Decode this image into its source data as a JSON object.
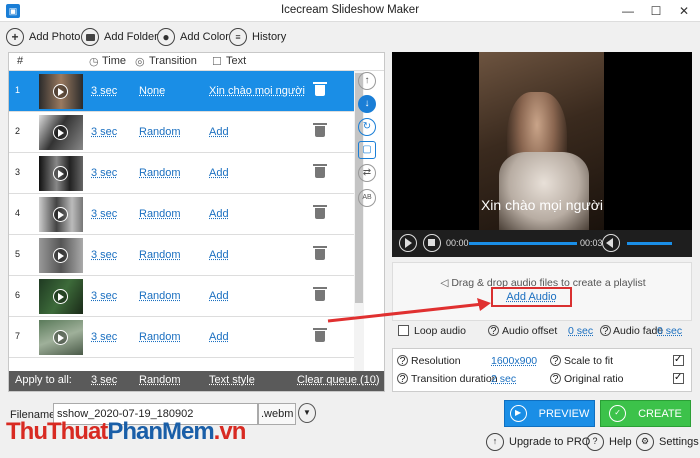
{
  "window": {
    "title": "Icecream Slideshow Maker",
    "icon": "app-logo-icon"
  },
  "toolbar": [
    {
      "label": "Add Photo",
      "icon": "plus-icon"
    },
    {
      "label": "Add Folder",
      "icon": "folder-icon"
    },
    {
      "label": "Add Color",
      "icon": "palette-icon"
    },
    {
      "label": "History",
      "icon": "list-icon"
    }
  ],
  "list": {
    "headers": {
      "num": "#",
      "time": "Time",
      "transition": "Transition",
      "text": "Text"
    },
    "rows": [
      {
        "index": "1",
        "time": "3 sec",
        "transition": "None",
        "text": "Xin chào mọi người",
        "selected": true
      },
      {
        "index": "2",
        "time": "3 sec",
        "transition": "Random",
        "text": "Add",
        "selected": false
      },
      {
        "index": "3",
        "time": "3 sec",
        "transition": "Random",
        "text": "Add",
        "selected": false
      },
      {
        "index": "4",
        "time": "3 sec",
        "transition": "Random",
        "text": "Add",
        "selected": false
      },
      {
        "index": "5",
        "time": "3 sec",
        "transition": "Random",
        "text": "Add",
        "selected": false
      },
      {
        "index": "6",
        "time": "3 sec",
        "transition": "Random",
        "text": "Add",
        "selected": false
      },
      {
        "index": "7",
        "time": "3 sec",
        "transition": "Random",
        "text": "Add",
        "selected": false
      }
    ],
    "apply_all": {
      "label": "Apply to all:",
      "time": "3 sec",
      "transition": "Random",
      "text_style": "Text style",
      "clear": "Clear queue (10)"
    }
  },
  "side_tools": [
    "move-up-icon",
    "move-down-icon",
    "rotate-icon",
    "crop-icon",
    "shuffle-icon",
    "ab-text-icon"
  ],
  "preview": {
    "caption": "Xin chào mọi người",
    "time_start": "00:00",
    "time_end": "00:03"
  },
  "audio": {
    "hint": "Drag & drop audio files to create a playlist",
    "add_audio": "Add Audio",
    "loop_label": "Loop audio",
    "offset_label": "Audio offset",
    "offset_value": "0 sec",
    "fade_label": "Audio fade",
    "fade_value": "0 sec"
  },
  "settings": {
    "resolution_label": "Resolution",
    "resolution_value": "1600x900",
    "transition_label": "Transition duration",
    "transition_value": "2 sec",
    "scale_label": "Scale to fit",
    "ratio_label": "Original ratio"
  },
  "output": {
    "filename_label": "Filename:",
    "filename": "sshow_2020-07-19_180902",
    "extension": ".webm",
    "preview_label": "PREVIEW",
    "create_label": "CREATE"
  },
  "footer": {
    "upgrade": "Upgrade to PRO",
    "help": "Help",
    "settings": "Settings"
  },
  "watermark": {
    "part1": "ThuThuat",
    "part2": "PhanMem",
    "part3": ".vn"
  },
  "colors": {
    "accent": "#1a8ee6",
    "create": "#3cc24a",
    "highlight": "#d93030"
  }
}
